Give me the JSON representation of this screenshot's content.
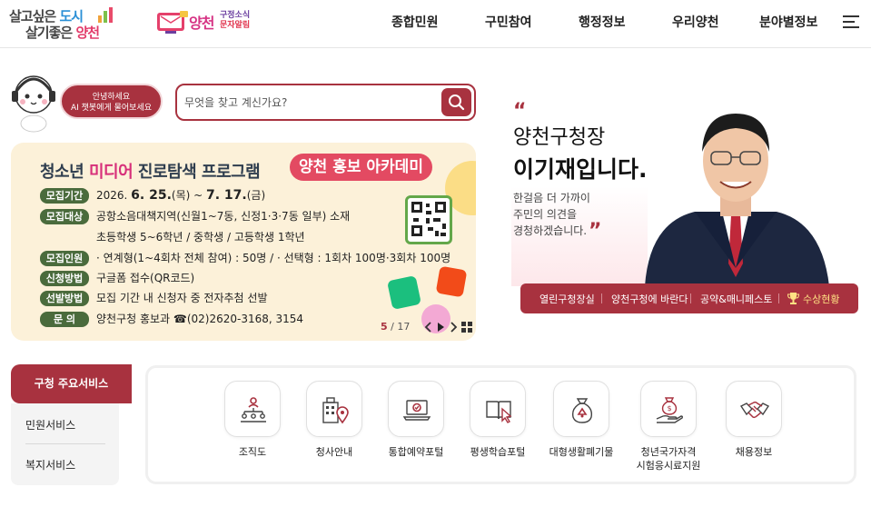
{
  "logo": {
    "line1_a": "살고싶은 ",
    "line1_b": "도시",
    "line2_a": "살기좋은 ",
    "line2_b": "양천"
  },
  "news": {
    "brand": "양천",
    "line1": "구정소식",
    "line2": "문자알림"
  },
  "nav": [
    "종합민원",
    "구민참여",
    "행정정보",
    "우리양천",
    "분야별정보"
  ],
  "chatbot": {
    "line1": "안녕하세요",
    "line2": "AI 챗봇에게 물어보세요"
  },
  "search": {
    "placeholder": "무엇을 찾고 계신가요?"
  },
  "banner": {
    "title_a": "청소년 ",
    "title_b": "미디어",
    "title_c": " 진로탐색 프로그램",
    "pill": "양천 홍보 아카데미",
    "rows": [
      {
        "tag": "모집기간",
        "text_a": "2026. ",
        "text_big1": "6. 25.",
        "text_b": "(목) ~ ",
        "text_big2": "7. 17.",
        "text_c": "(금)"
      },
      {
        "tag": "모집대상",
        "text": "공항소음대책지역(신월1~7동, 신정1·3·7동 일부) 소재"
      },
      {
        "tag": "",
        "text": "초등학생 5~6학년 / 중학생 / 고등학생 1학년"
      },
      {
        "tag": "모집인원",
        "text": "· 연계형(1~4회차 전체 참여) : 50명 / · 선택형 : 1회차 100명·3회차 100명"
      },
      {
        "tag": "신청방법",
        "text": "구글폼 접수(QR코드)"
      },
      {
        "tag": "선발방법",
        "text": "모집 기간 내 신청자 중 전자추첨 선발"
      },
      {
        "tag": "문    의",
        "text": "양천구청 홍보과 ☎(02)2620-3168, 3154"
      }
    ],
    "pager_current": "5",
    "pager_total": "/ 17"
  },
  "mayor": {
    "title1": "양천구청장",
    "title2": "이기재입니다.",
    "msg1": "한걸음 더 가까이",
    "msg2": "주민의 의견을",
    "msg3": "경청하겠습니다.",
    "links": [
      "열린구청장실",
      "양천구청에 바란다",
      "공약&매니페스토",
      "수상현황"
    ]
  },
  "services": {
    "active_tab": "구청 주요서비스",
    "tabs": [
      "민원서비스",
      "복지서비스"
    ],
    "items": [
      {
        "label": "조직도",
        "icon": "org-chart-icon"
      },
      {
        "label": "청사안내",
        "icon": "building-location-icon"
      },
      {
        "label": "통합예약포털",
        "icon": "laptop-booking-icon"
      },
      {
        "label": "평생학습포털",
        "icon": "book-cursor-icon"
      },
      {
        "label": "대형생활폐기물",
        "icon": "recycle-bag-icon"
      },
      {
        "label": "청년국가자격\n시험응시료지원",
        "icon": "money-hand-icon"
      },
      {
        "label": "채용정보",
        "icon": "handshake-icon"
      }
    ]
  },
  "colors": {
    "brand": "#a8323f",
    "banner_bg": "#fcf1d9",
    "tag_green": "#4a6b3c",
    "pink": "#e34a62"
  }
}
